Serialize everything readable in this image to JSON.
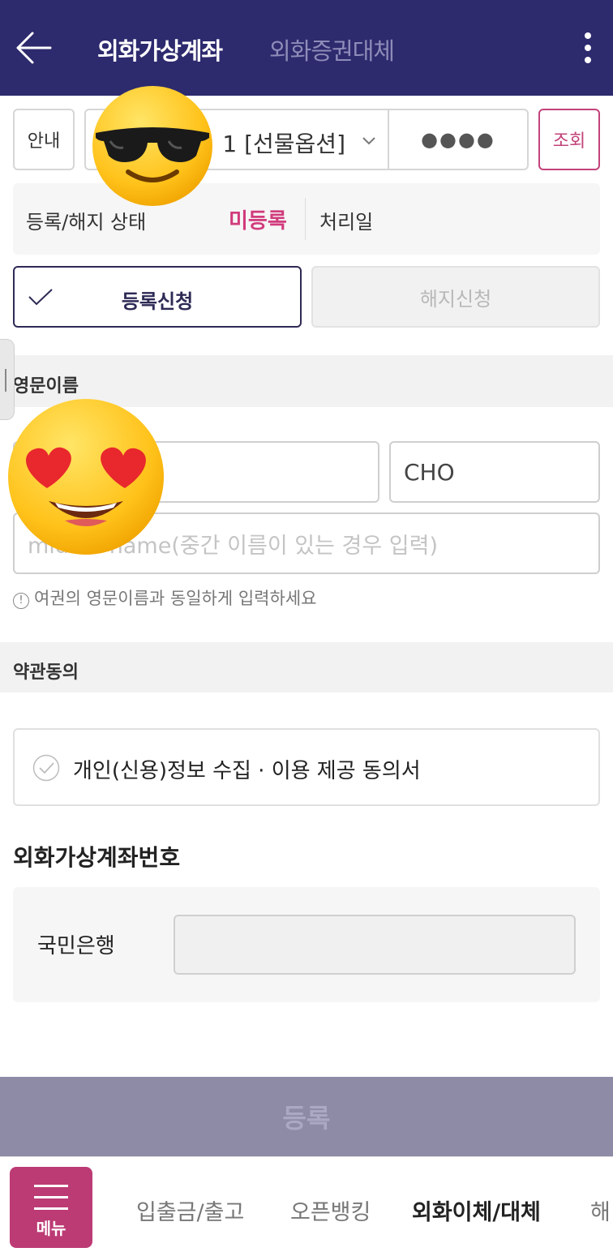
{
  "header": {
    "tab_active": "외화가상계좌",
    "tab_inactive": "외화증권대체"
  },
  "account_row": {
    "info_label": "안내",
    "account_text": "1 [선물옵션]",
    "password_mask": "●●●●",
    "lookup_label": "조회"
  },
  "status": {
    "label": "등록/해지 상태",
    "value": "미등록",
    "date_label": "처리일",
    "value_color": "#d13b7c"
  },
  "actions": {
    "register_label": "등록신청",
    "cancel_label": "해지신청"
  },
  "english_name": {
    "section_title": "영문이름",
    "first_name": "",
    "last_name": "CHO",
    "middle_placeholder": "middle name(중간 이름이 있는 경우 입력)",
    "hint": "여권의 영문이름과 동일하게 입력하세요"
  },
  "terms": {
    "section_title": "약관동의",
    "agreement_label": "개인(신용)정보 수집 · 이용 제공 동의서"
  },
  "virtual_account": {
    "title": "외화가상계좌번호",
    "bank_name": "국민은행",
    "number": ""
  },
  "submit_label": "등록",
  "bottom_nav": {
    "menu_label": "메뉴",
    "items": [
      "입출금/출고",
      "오픈뱅킹",
      "외화이체/대체",
      "해"
    ]
  },
  "colors": {
    "header_bg": "#2d2a6e",
    "accent": "#bc3b74",
    "submit_bg": "#8d8ba6"
  }
}
